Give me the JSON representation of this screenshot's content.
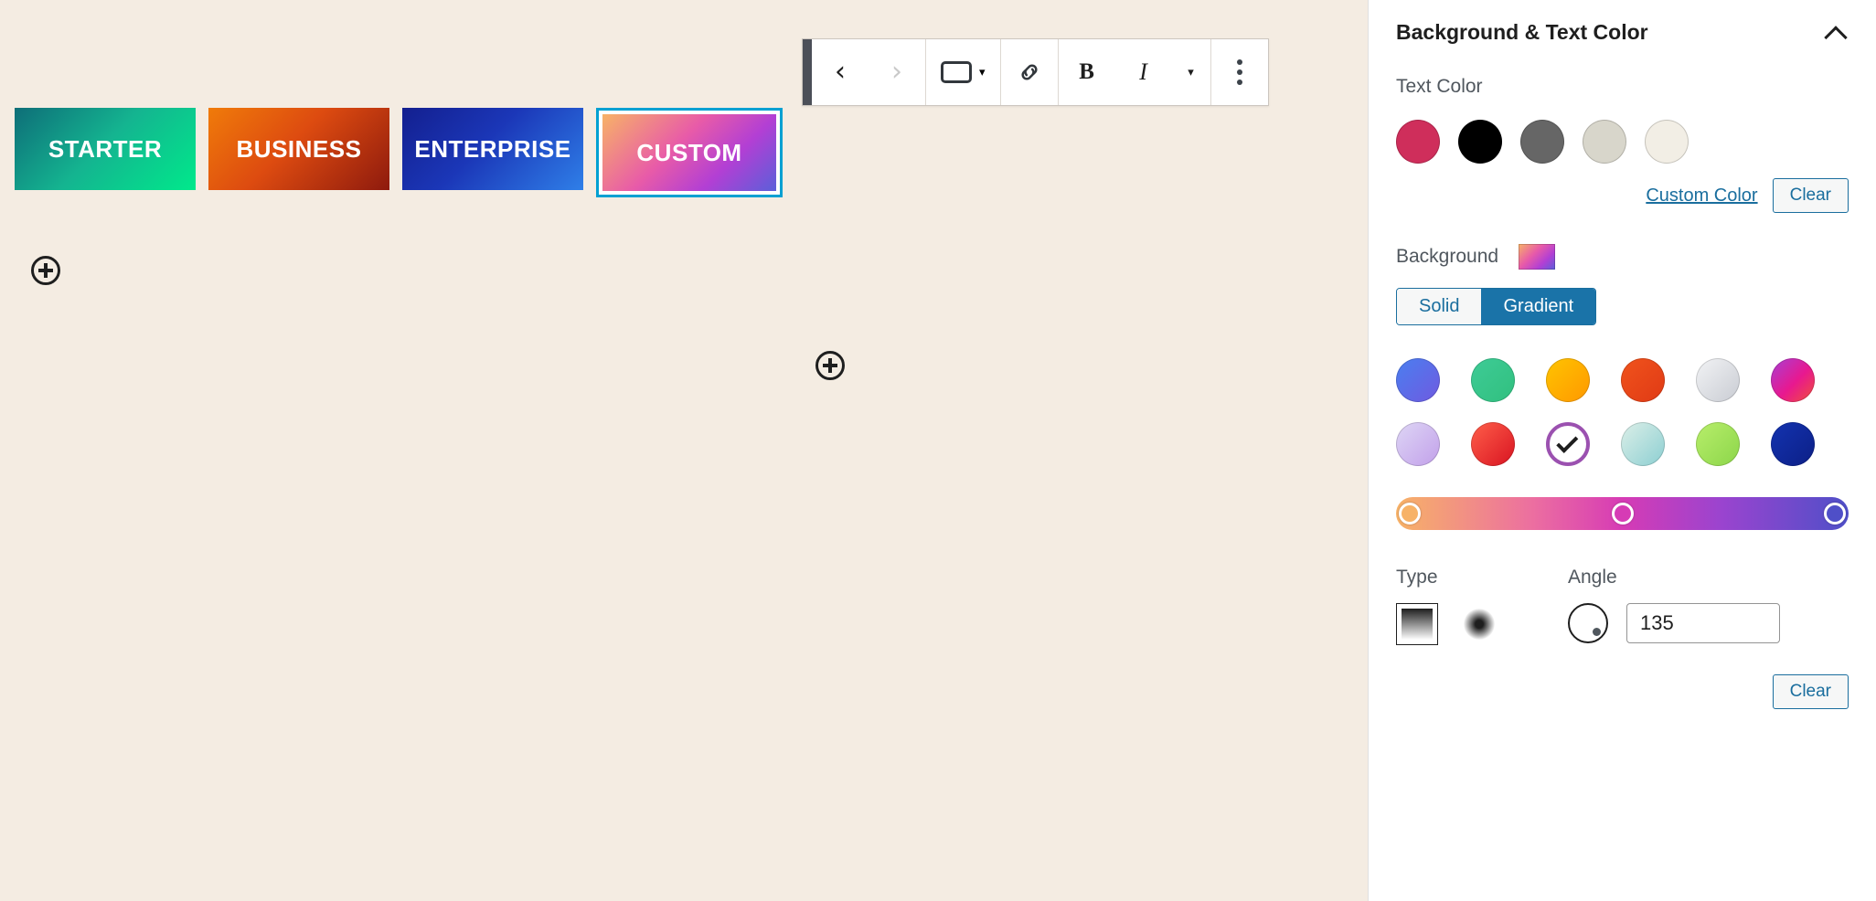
{
  "canvas": {
    "background_color": "#f4ece2",
    "toolbar": {
      "drag_handle_name": "drag-handle",
      "buttons": [
        {
          "name": "move-previous-button",
          "glyph": "‹",
          "label": "Move left",
          "disabled": false
        },
        {
          "name": "move-next-button",
          "glyph": "›",
          "label": "Move right",
          "disabled": true
        },
        {
          "name": "block-type-button",
          "glyph": "",
          "label": "Buttons",
          "disabled": false
        },
        {
          "name": "block-type-caret",
          "glyph": "▾",
          "label": "Change block type",
          "disabled": false
        },
        {
          "name": "link-button",
          "glyph": "🔗",
          "label": "Link",
          "disabled": false
        },
        {
          "name": "bold-button",
          "glyph": "B",
          "label": "Bold",
          "disabled": false
        },
        {
          "name": "italic-button",
          "glyph": "I",
          "label": "Italic",
          "disabled": false
        },
        {
          "name": "more-rich-text-caret",
          "glyph": "▾",
          "label": "More rich text controls",
          "disabled": false
        },
        {
          "name": "options-button",
          "glyph": "⋮",
          "label": "Options",
          "disabled": false
        }
      ]
    },
    "pricing_buttons": [
      {
        "label": "STARTER",
        "gradient": "linear-gradient(135deg, #0e6e78 0%, #14b490 48%, #00e98b 100%)",
        "selected": false
      },
      {
        "label": "BUSINESS",
        "gradient": "linear-gradient(135deg, #f07b0a 0%, #dd4b10 45%, #8e1a0d 100%)",
        "selected": false
      },
      {
        "label": "ENTERPRISE",
        "gradient": "linear-gradient(135deg, #131f8f 0%, #1b37b8 45%, #2f7fe8 100%)",
        "selected": false
      },
      {
        "label": "CUSTOM",
        "gradient": "linear-gradient(135deg, #f7b267 0%, #e85ba8 42%, #b23fd4 70%, #5b5fd9 100%)",
        "selected": true
      }
    ],
    "selection_border_color": "#00a0d2",
    "inserters": [
      {
        "name": "block-inserter-left",
        "label": "Add block"
      },
      {
        "name": "block-inserter-right",
        "label": "Add block"
      }
    ]
  },
  "sidebar": {
    "panel_title": "Background & Text Color",
    "collapse_icon": "chevron-up-icon",
    "text_color": {
      "label": "Text Color",
      "swatches": [
        {
          "name": "text-color-crimson",
          "color": "#cf2e5b"
        },
        {
          "name": "text-color-black",
          "color": "#000000"
        },
        {
          "name": "text-color-gray",
          "color": "#666666"
        },
        {
          "name": "text-color-light-gray",
          "color": "#d8d6cb"
        },
        {
          "name": "text-color-cream",
          "color": "#f2eee5"
        }
      ],
      "custom_link": "Custom Color",
      "clear_label": "Clear"
    },
    "background": {
      "label": "Background",
      "preview_gradient": "linear-gradient(135deg, #f7b267 0%, #e85ba8 40%, #b23fd4 70%, #5b5fd9 100%)",
      "tabs": [
        {
          "name": "solid-tab",
          "label": "Solid",
          "active": false
        },
        {
          "name": "gradient-tab",
          "label": "Gradient",
          "active": true
        }
      ],
      "gradient_swatches": [
        {
          "name": "gradient-blue-purple",
          "gradient": "linear-gradient(135deg, #4a7ff0 0%, #6f5ae0 100%)",
          "selected": false
        },
        {
          "name": "gradient-green-mint",
          "gradient": "linear-gradient(135deg, #3ecb96 0%, #31c07f 100%)",
          "selected": false
        },
        {
          "name": "gradient-yellow-orange",
          "gradient": "linear-gradient(135deg, #ffc400 0%, #ff9800 100%)",
          "selected": false
        },
        {
          "name": "gradient-orange-red",
          "gradient": "linear-gradient(135deg, #f0531c 0%, #e03a15 100%)",
          "selected": false
        },
        {
          "name": "gradient-white-gray",
          "gradient": "linear-gradient(135deg, #f2f3f5 0%, #c9ccd3 100%)",
          "selected": false
        },
        {
          "name": "gradient-purple-pink",
          "gradient": "linear-gradient(135deg, #a83fd4 0%, #e8188f 55%, #f0503a 100%)",
          "selected": false
        },
        {
          "name": "gradient-lavender",
          "gradient": "linear-gradient(135deg, #ded6f5 0%, #c2a0ea 100%)",
          "selected": false
        },
        {
          "name": "gradient-red",
          "gradient": "linear-gradient(135deg, #ff5f4a 0%, #d81321 100%)",
          "selected": false
        },
        {
          "name": "gradient-custom-active",
          "gradient": "linear-gradient(135deg, #f7b267 0%, #e85ba8 40%, #b23fd4 70%, #5b5fd9 100%)",
          "selected": true
        },
        {
          "name": "gradient-pale-teal",
          "gradient": "linear-gradient(135deg, #dcefe8 0%, #8ccfd2 100%)",
          "selected": false
        },
        {
          "name": "gradient-light-green",
          "gradient": "linear-gradient(135deg, #b8ee6b 0%, #8cd64a 100%)",
          "selected": false
        },
        {
          "name": "gradient-deep-blue",
          "gradient": "linear-gradient(135deg, #1333b0 0%, #0c1f86 100%)",
          "selected": false
        }
      ],
      "slider": {
        "name": "gradient-stop-slider",
        "gradient": "linear-gradient(90deg, #f7b267 0%, #ec6fa0 30%, #d63bb5 50%, #9a44cf 72%, #4f4fc8 100%)",
        "stops": [
          {
            "name": "gradient-stop-0",
            "position_percent": 3,
            "color": "#f7b267"
          },
          {
            "name": "gradient-stop-1",
            "position_percent": 50,
            "color": "#d63bb5"
          },
          {
            "name": "gradient-stop-2",
            "position_percent": 97,
            "color": "#4f4fc8"
          }
        ]
      },
      "type": {
        "label": "Type",
        "linear": {
          "name": "gradient-type-linear",
          "label": "Linear",
          "selected": true
        },
        "radial": {
          "name": "gradient-type-radial",
          "label": "Radial",
          "selected": false
        }
      },
      "angle": {
        "label": "Angle",
        "value": "135",
        "placeholder": "0"
      },
      "clear_label": "Clear"
    }
  }
}
